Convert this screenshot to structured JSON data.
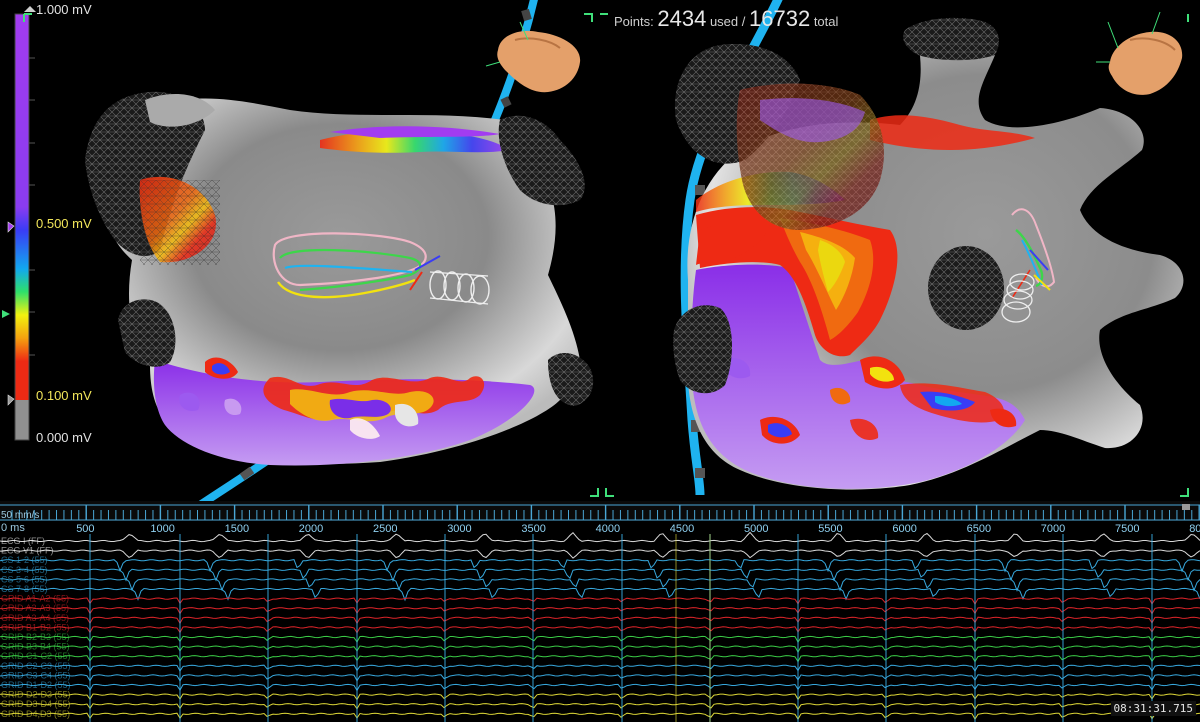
{
  "header": {
    "points_label": "Points:",
    "points_used": "2434",
    "used_word": "used /",
    "points_total": "16732",
    "total_word": "total"
  },
  "voltage_scale": {
    "top": "1.000 mV",
    "upper_threshold": "0.500 mV",
    "lower_threshold": "0.100 mV",
    "bottom": "0.000 mV"
  },
  "colors": {
    "scar_gray": "#8a8a8a",
    "healthy_purple": "#a23cf0",
    "catheter_blue": "#1fb3f0",
    "threshold_green": "#3fe07a"
  },
  "timeline": {
    "speed": "50 mm/s",
    "unit": "0 ms",
    "ticks": [
      "500",
      "1000",
      "1500",
      "2000",
      "2500",
      "3000",
      "3500",
      "4000",
      "4500",
      "5000",
      "5500",
      "6000",
      "6500",
      "7000",
      "7500",
      "80"
    ]
  },
  "channels": [
    {
      "label": "ECG I (FF)",
      "color": "#ffffff"
    },
    {
      "label": "ECG V1 (FF)",
      "color": "#ffffff"
    },
    {
      "label": "CS 1-2 (55)",
      "color": "#3ab0e8"
    },
    {
      "label": "CS 3-4 (55)",
      "color": "#3ab0e8"
    },
    {
      "label": "CS 5-6 (55)",
      "color": "#3ab0e8"
    },
    {
      "label": "CS 7-8 (55)",
      "color": "#3ab0e8"
    },
    {
      "label": "GRID A1-A2 (55)",
      "color": "#e8262b"
    },
    {
      "label": "GRID A2-A3 (55)",
      "color": "#e8262b"
    },
    {
      "label": "GRID A3-A4 (55)",
      "color": "#e8262b"
    },
    {
      "label": "GRID B1-B2 (55)",
      "color": "#e8262b"
    },
    {
      "label": "GRID B2-B3 (55)",
      "color": "#3dd64a"
    },
    {
      "label": "GRID B3-B4 (55)",
      "color": "#3dd64a"
    },
    {
      "label": "GRID C1-C2 (55)",
      "color": "#3dd64a"
    },
    {
      "label": "GRID C2-C3 (55)",
      "color": "#3ab0e8"
    },
    {
      "label": "GRID C3-C4 (55)",
      "color": "#3ab0e8"
    },
    {
      "label": "GRID D1-D2 (55)",
      "color": "#3ab0e8"
    },
    {
      "label": "GRID D2-D3 (55)",
      "color": "#e8e23a"
    },
    {
      "label": "GRID D3-D4 (55)",
      "color": "#e8e23a"
    },
    {
      "label": "GRID D4,D3 (55)",
      "color": "#e8e23a"
    }
  ],
  "status": {
    "clock": "08:31:31.715"
  }
}
